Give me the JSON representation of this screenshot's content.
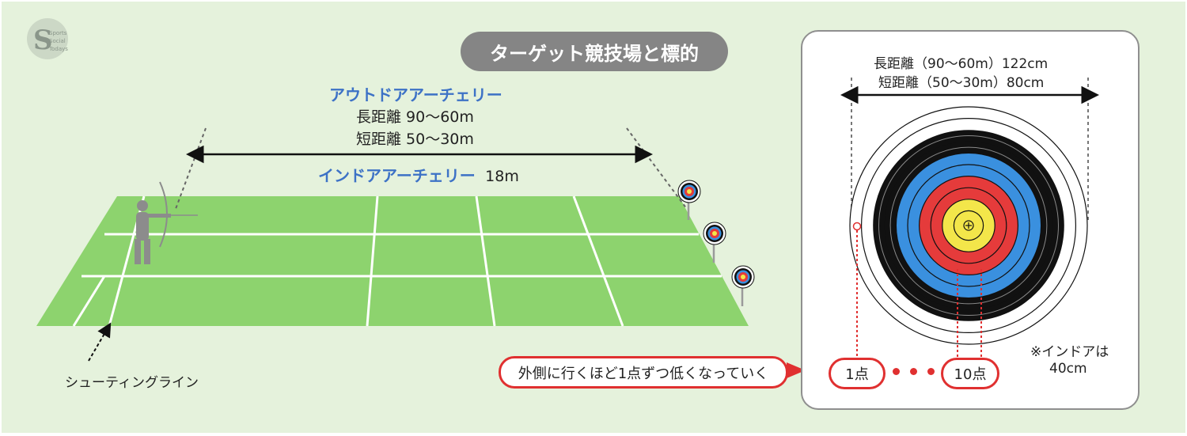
{
  "title": "ターゲット競技場と標的",
  "outdoor": {
    "heading": "アウトドアアーチェリー",
    "long": "長距離 90〜60m",
    "short": "短距離 50〜30m"
  },
  "indoor": {
    "heading": "インドアアーチェリー",
    "distance": "18m"
  },
  "shooting_line_label": "シューティングライン",
  "target_panel": {
    "long_size": "長距離（90〜60m）122cm",
    "short_size": "短距離（50〜30m）80cm",
    "indoor_note_line1": "※インドアは",
    "indoor_note_line2": "40cm"
  },
  "scoring": {
    "explanation": "外側に行くほど1点ずつ低くなっていく",
    "min_point": "1点",
    "max_point": "10点"
  },
  "ring_colors": [
    "#ffffff",
    "#ffffff",
    "#111111",
    "#111111",
    "#3a90df",
    "#3a90df",
    "#e53b3b",
    "#e53b3b",
    "#f3e64a",
    "#f3e64a"
  ],
  "field_color": "#8dd36e",
  "accent_blue": "#3d72c6",
  "accent_red": "#e03030"
}
